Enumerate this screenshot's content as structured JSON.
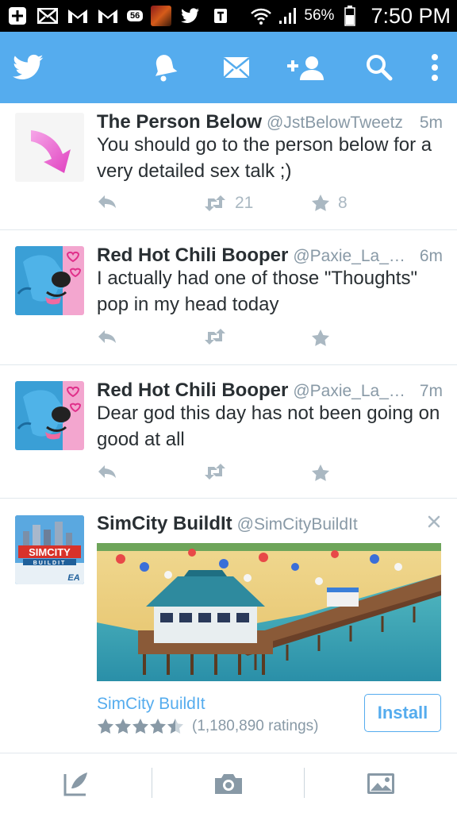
{
  "status_bar": {
    "battery": "56%",
    "time": "7:50 PM",
    "badge": "56"
  },
  "header": {
    "icons": [
      "twitter-bird-icon",
      "bell-icon",
      "envelope-icon",
      "add-user-icon",
      "search-icon",
      "overflow-menu-icon"
    ]
  },
  "colors": {
    "brand": "#55acee",
    "text": "#292f33",
    "muted": "#8899a6",
    "action": "#aab8c2"
  },
  "tweets": [
    {
      "name": "The Person Below",
      "handle": "@JstBelowTweetz",
      "time": "5m",
      "text": "You should go to the person below for a very detailed sex talk ;)",
      "retweets": "21",
      "favorites": "8"
    },
    {
      "name": "Red Hot Chili Booper",
      "handle": "@Paxie_La_Fl...",
      "time": "6m",
      "text": "I actually had one of those \"Thoughts\" pop in my head today",
      "retweets": "",
      "favorites": ""
    },
    {
      "name": "Red Hot Chili Booper",
      "handle": "@Paxie_La_Fl...",
      "time": "7m",
      "text": "Dear god this day has not been going on good at all",
      "retweets": "",
      "favorites": ""
    }
  ],
  "ad": {
    "name": "SimCity BuildIt",
    "handle": "@SimCityBuildIt",
    "app_name": "SimCity BuildIt",
    "rating_text": "(1,180,890 ratings)",
    "rating": 4.5,
    "install_label": "Install",
    "logo_text": "SIMCITY",
    "logo_sub": "BUILDIT",
    "logo_brand": "EA"
  },
  "bottom_bar": {
    "icons": [
      "compose-tweet-icon",
      "camera-icon",
      "photo-gallery-icon"
    ]
  }
}
